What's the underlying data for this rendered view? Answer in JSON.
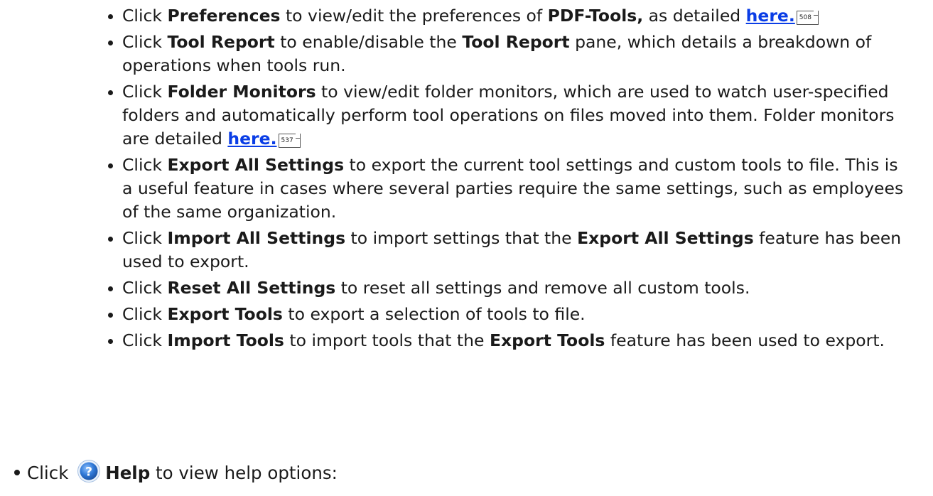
{
  "items": [
    {
      "lead": "Click ",
      "bold": "Preferences",
      "middle": " to view/edit the preferences of ",
      "bold2": "PDF-Tools,",
      "tail": " as detailed ",
      "link": "here.",
      "page_ref": "508"
    },
    {
      "lead": "Click ",
      "bold": "Tool Report",
      "middle": " to enable/disable the ",
      "bold2": "Tool Report",
      "tail": " pane, which details a breakdown of operations when tools run."
    },
    {
      "lead": "Click ",
      "bold": "Folder Monitors",
      "middle": " to view/edit folder monitors, which are used to watch user-specified folders and automatically perform tool operations on files moved into them. Folder monitors are detailed ",
      "link": "here.",
      "page_ref": "537"
    },
    {
      "lead": "Click ",
      "bold": "Export All Settings",
      "middle": " to export the current tool settings and custom tools to file. This is a useful feature in cases where several parties require the same settings, such as employees of the same organization."
    },
    {
      "lead": "Click ",
      "bold": "Import All Settings",
      "middle": " to import settings that the ",
      "bold2": "Export All Settings",
      "tail": " feature has been used to export."
    },
    {
      "lead": "Click ",
      "bold": "Reset All Settings",
      "middle": " to reset all settings and remove all custom tools."
    },
    {
      "lead": "Click ",
      "bold": "Export Tools",
      "middle": " to export a selection of tools to file."
    },
    {
      "lead": "Click ",
      "bold": "Import Tools",
      "middle": " to import tools that the ",
      "bold2": "Export Tools",
      "tail": " feature has been used to export."
    }
  ],
  "main_item": {
    "lead": "Click",
    "icon": "help-question-icon",
    "bold": "Help",
    "tail": " to view help options:"
  },
  "colors": {
    "link": "#0a3de6",
    "icon_blue": "#1f5fc4"
  }
}
